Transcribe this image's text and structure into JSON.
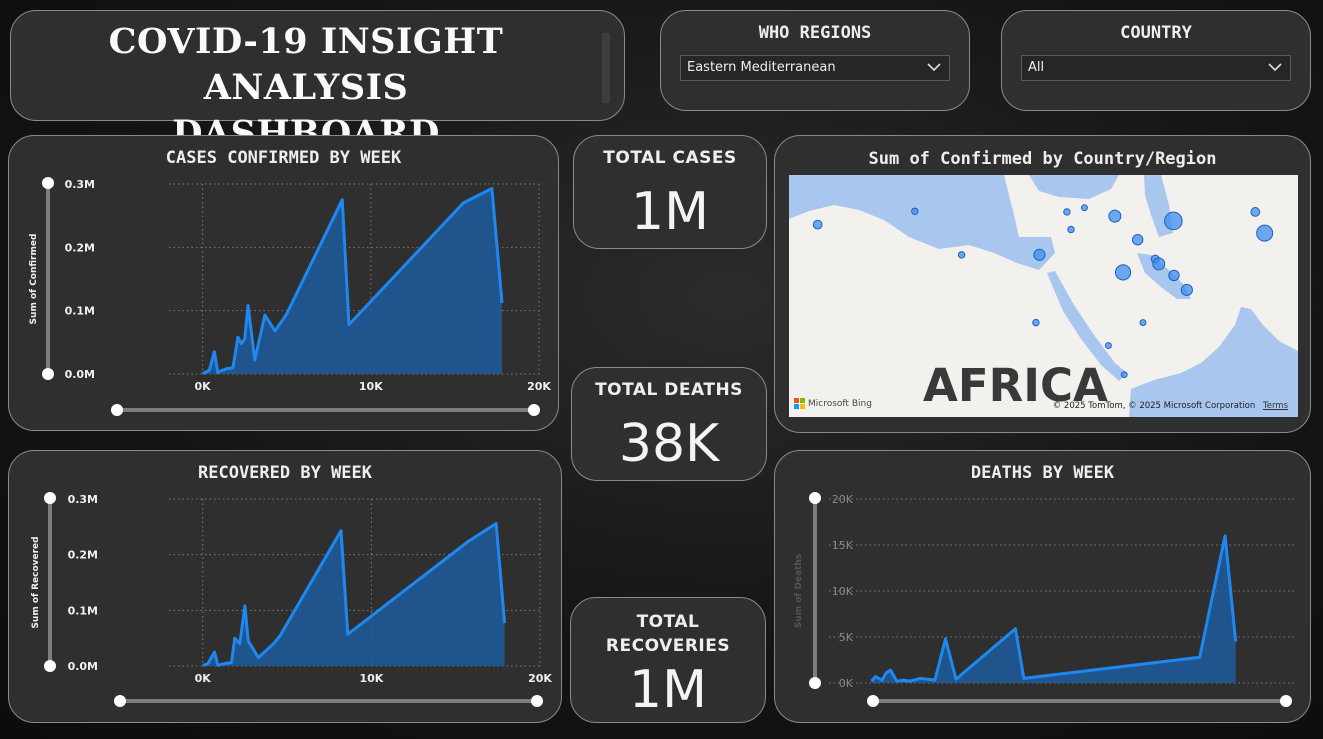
{
  "header": {
    "title_line1": "COVID-19  INSIGHT ANALYSIS",
    "title_line2": "DASHBOARD"
  },
  "slicers": {
    "region": {
      "label": "WHO REGIONS",
      "selected": "Eastern Mediterranean"
    },
    "country": {
      "label": "COUNTRY",
      "selected": "All"
    }
  },
  "kpis": {
    "cases": {
      "label": "TOTAL CASES",
      "value": "1M"
    },
    "deaths": {
      "label": "TOTAL DEATHS",
      "value": "38K"
    },
    "recoveries": {
      "label_line1": "TOTAL",
      "label_line2": "RECOVERIES",
      "value": "1M"
    }
  },
  "map": {
    "title": "Sum of Confirmed by Country/Region",
    "continent_label": "AFRICA",
    "brand": "Microsoft Bing",
    "copyright": "© 2025 TomTom, © 2025 Microsoft Corporation",
    "terms": "Terms",
    "colors": {
      "land": "#f2f1ee",
      "water": "#a9c6ee",
      "bubble": "#3d8ef0"
    },
    "bubbles": [
      {
        "lon": -7.1,
        "lat": 31.8,
        "size": 0.3
      },
      {
        "lon": 9.5,
        "lat": 34.0,
        "size": 0.15
      },
      {
        "lon": 17.5,
        "lat": 26.8,
        "size": 0.15
      },
      {
        "lon": 30.8,
        "lat": 26.8,
        "size": 0.45
      },
      {
        "lon": 35.5,
        "lat": 33.9,
        "size": 0.15
      },
      {
        "lon": 38.5,
        "lat": 34.6,
        "size": 0.12
      },
      {
        "lon": 36.2,
        "lat": 31.0,
        "size": 0.15
      },
      {
        "lon": 43.7,
        "lat": 33.2,
        "size": 0.5
      },
      {
        "lon": 47.6,
        "lat": 29.3,
        "size": 0.4
      },
      {
        "lon": 50.6,
        "lat": 26.1,
        "size": 0.25
      },
      {
        "lon": 51.2,
        "lat": 25.3,
        "size": 0.5
      },
      {
        "lon": 45.1,
        "lat": 23.9,
        "size": 0.7
      },
      {
        "lon": 53.8,
        "lat": 23.4,
        "size": 0.4
      },
      {
        "lon": 56.0,
        "lat": 21.0,
        "size": 0.45
      },
      {
        "lon": 53.7,
        "lat": 32.4,
        "size": 0.85
      },
      {
        "lon": 67.7,
        "lat": 33.9,
        "size": 0.3
      },
      {
        "lon": 69.3,
        "lat": 30.4,
        "size": 0.75
      },
      {
        "lon": 48.5,
        "lat": 15.6,
        "size": 0.12
      },
      {
        "lon": 30.2,
        "lat": 15.6,
        "size": 0.15
      },
      {
        "lon": 42.6,
        "lat": 11.8,
        "size": 0.12
      },
      {
        "lon": 45.3,
        "lat": 7.0,
        "size": 0.12
      }
    ]
  },
  "chart_data": [
    {
      "type": "area",
      "title": "CASES CONFIRMED BY WEEK",
      "xlabel": "",
      "ylabel": "Sum of Confirmed",
      "xlim": [
        -2000,
        20000
      ],
      "ylim": [
        0,
        300000
      ],
      "xticks": [
        "0K",
        "10K",
        "20K"
      ],
      "yticks": [
        "0.0M",
        "0.1M",
        "0.2M",
        "0.3M"
      ],
      "color": "#1e88f0",
      "x": [
        0,
        200,
        400,
        700,
        900,
        1100,
        1400,
        1800,
        2100,
        2300,
        2500,
        2700,
        3100,
        3700,
        4300,
        5000,
        8300,
        8700,
        15500,
        17200,
        17800
      ],
      "values": [
        1000,
        3000,
        6000,
        35000,
        2000,
        5000,
        8000,
        10000,
        58000,
        48000,
        55000,
        108000,
        22000,
        93000,
        68000,
        95000,
        275000,
        78000,
        270000,
        293000,
        112000
      ]
    },
    {
      "type": "area",
      "title": "RECOVERED BY WEEK",
      "xlabel": "",
      "ylabel": "Sum of Recovered",
      "xlim": [
        -2000,
        20000
      ],
      "ylim": [
        0,
        300000
      ],
      "xticks": [
        "0K",
        "10K",
        "20K"
      ],
      "yticks": [
        "0.0M",
        "0.1M",
        "0.2M",
        "0.3M"
      ],
      "color": "#1e88f0",
      "x": [
        0,
        300,
        700,
        900,
        1100,
        1400,
        1700,
        1900,
        2200,
        2500,
        2700,
        3300,
        4200,
        4600,
        8200,
        8600,
        15800,
        17400,
        17900
      ],
      "values": [
        1000,
        4000,
        25000,
        1000,
        3000,
        5000,
        6000,
        50000,
        40000,
        108000,
        45000,
        15000,
        40000,
        55000,
        243000,
        57000,
        225000,
        256000,
        77000
      ]
    },
    {
      "type": "area",
      "title": "DEATHS BY WEEK",
      "xlabel": "",
      "ylabel": "Sum of Deaths",
      "xlim": [
        -2000,
        20000
      ],
      "ylim": [
        0,
        20000
      ],
      "yticks": [
        "0K",
        "5K",
        "10K",
        "15K",
        "20K"
      ],
      "color": "#1e88f0",
      "x": [
        0,
        200,
        500,
        700,
        900,
        1200,
        1500,
        1800,
        2300,
        2700,
        3000,
        3500,
        4000,
        4300,
        6800,
        7200,
        15500,
        16700,
        17200
      ],
      "values": [
        200,
        700,
        300,
        1100,
        1400,
        200,
        300,
        200,
        500,
        400,
        300,
        4800,
        400,
        1000,
        5900,
        500,
        2800,
        16000,
        4500
      ]
    }
  ]
}
